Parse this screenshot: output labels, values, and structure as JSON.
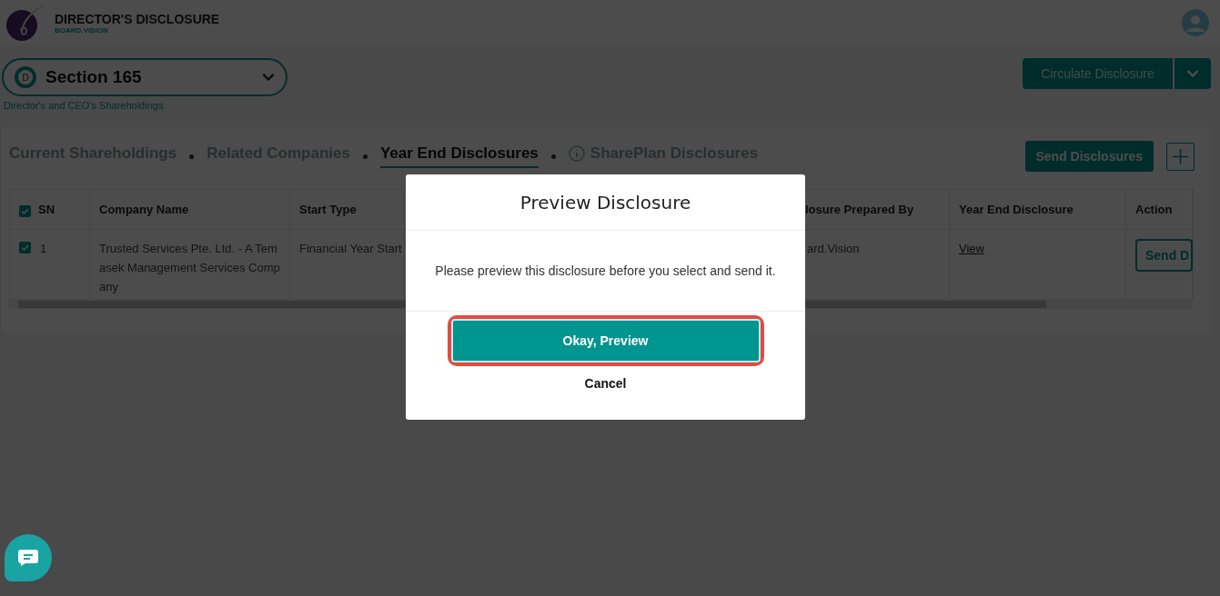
{
  "app": {
    "title": "DIRECTOR'S DISCLOSURE",
    "subtitle": "BOARD.VISION"
  },
  "section_select": {
    "badge": "D",
    "value": "Section 165"
  },
  "breadcrumb": "Director's and CEO's Shareholdings",
  "circulate_button": "Circulate Disclosure",
  "tabs": [
    {
      "label": "Current Shareholdings",
      "selected": false,
      "kind": "plain"
    },
    {
      "label": "Related Companies",
      "selected": false,
      "kind": "plain"
    },
    {
      "label": "Year End Disclosures",
      "selected": true,
      "kind": "plain"
    },
    {
      "label": "SharePlan Disclosures",
      "selected": false,
      "kind": "info"
    }
  ],
  "send_disclosures_button": "Send Disclosures",
  "table": {
    "select_all_checked": true,
    "columns": [
      "SN",
      "Company Name",
      "Start Type",
      "losure Prepared By",
      "Year End Disclosure",
      "Action"
    ],
    "rows": [
      {
        "checked": true,
        "sn": "1",
        "company": "Trusted Services Pte. Ltd. - A Temasek Management Services Company",
        "start_type": "Financial Year Start",
        "prepared_by": "ard.Vision",
        "disclosure": "View",
        "action": "Send D"
      }
    ]
  },
  "dialog": {
    "title": "Preview Disclosure",
    "message": "Please preview this disclosure before you select and send it.",
    "confirm": "Okay, Preview",
    "cancel": "Cancel",
    "confirm_highlighted": true
  }
}
